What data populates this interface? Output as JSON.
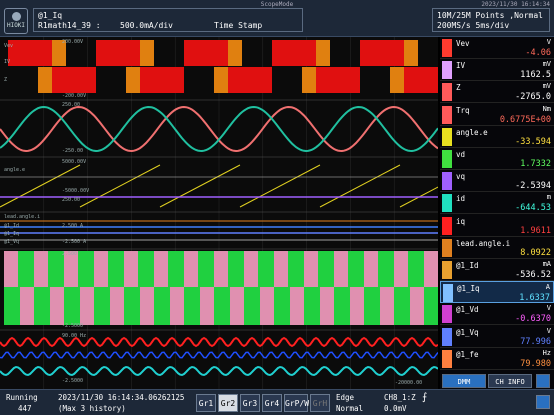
{
  "app_title": "ScopeMode",
  "datetime_top": "2023/11/30 16:14:34",
  "logo_text": "HIOKI",
  "header": {
    "line1": "@1_Iq",
    "line2_ch": "R1math14_39 :",
    "line2_scale": "500.0mA/div",
    "line2_mode": "Time Stamp"
  },
  "acquisition": {
    "line1": "10M/25M Points ,Normal",
    "line2": "200MS/s    5ms/div"
  },
  "channels": [
    {
      "name": "Vev",
      "unit": "V",
      "value": "-4.06",
      "color": "#ff3b2f",
      "val_color": "#ff6a5a"
    },
    {
      "name": "IV",
      "unit": "mV",
      "value": "1162.5",
      "color": "#e0a0ff",
      "val_color": "#ffffff"
    },
    {
      "name": "Z",
      "unit": "mV",
      "value": "-2765.0",
      "color": "#ff5a5a",
      "val_color": "#ffffff"
    },
    {
      "name": "Trq",
      "unit": "Nm",
      "value": "0.6775E+00",
      "color": "#ff5a5a",
      "val_color": "#ff6a5a"
    },
    {
      "name": "angle.e",
      "unit": "",
      "value": "-33.594",
      "color": "#e8e020",
      "val_color": "#ffe040"
    },
    {
      "name": "vd",
      "unit": "",
      "value": "1.7332",
      "color": "#40e040",
      "val_color": "#60ff60"
    },
    {
      "name": "vq",
      "unit": "",
      "value": "-2.5394",
      "color": "#a060ff",
      "val_color": "#ffffff"
    },
    {
      "name": "id",
      "unit": "m",
      "value": "-644.53",
      "color": "#20e0c0",
      "val_color": "#40ffe0"
    },
    {
      "name": "iq",
      "unit": "",
      "value": "1.9611",
      "color": "#ff2020",
      "val_color": "#ff4040"
    },
    {
      "name": "lead.angle.i",
      "unit": "",
      "value": "8.0922",
      "color": "#e08020",
      "val_color": "#ffe040"
    },
    {
      "name": "@1_Id",
      "unit": "mA",
      "value": "-536.52",
      "color": "#e8a030",
      "val_color": "#ffffff"
    },
    {
      "name": "@1_Iq",
      "unit": "A",
      "value": "1.6337",
      "color": "#80c0ff",
      "val_color": "#60e0ff"
    },
    {
      "name": "@1_Vd",
      "unit": "V",
      "value": "-0.6370",
      "color": "#d040d0",
      "val_color": "#ff60ff"
    },
    {
      "name": "@1_Vq",
      "unit": "V",
      "value": "77.996",
      "color": "#6080ff",
      "val_color": "#6080ff"
    },
    {
      "name": "@1_fe",
      "unit": "Hz",
      "value": "79.980",
      "color": "#ff8040",
      "val_color": "#ff9040"
    }
  ],
  "right_tabs": {
    "dmm": "DMM",
    "chinfo": "CH INFO"
  },
  "bottom": {
    "status": "Running",
    "count": "447",
    "time": "2023/11/30 16:14:34.06262125",
    "history": "(Max 3 history)",
    "groups": [
      "Gr1",
      "Gr2",
      "Gr3",
      "Gr4",
      "GrP/W",
      "GrH"
    ],
    "trig_type": "Edge",
    "trig_mode": "Normal",
    "trig_ch": "CH8_1:Z",
    "trig_level": "0.0mV"
  },
  "labels": {
    "l1": "200.00V",
    "l2": "-200.00V",
    "l3": "Vev",
    "l4": "IV",
    "l5": "Z",
    "l6": "250.00",
    "l7": "-250.00",
    "l8": "5000.00V",
    "l9": "angle.e",
    "l10": "250.00",
    "l11": "-5000.00V",
    "l12": "lead.angle.i",
    "l13": "@1_Id",
    "l14": "@1_Iq",
    "l15": "@1_Vq",
    "l16": "2.500 A",
    "l17": "-2.500 A",
    "l18": "2.500",
    "l19": "-2.5000",
    "l20": "90.00 Hz",
    "l21": "-2.5000",
    "l22": "-20000.00"
  }
}
